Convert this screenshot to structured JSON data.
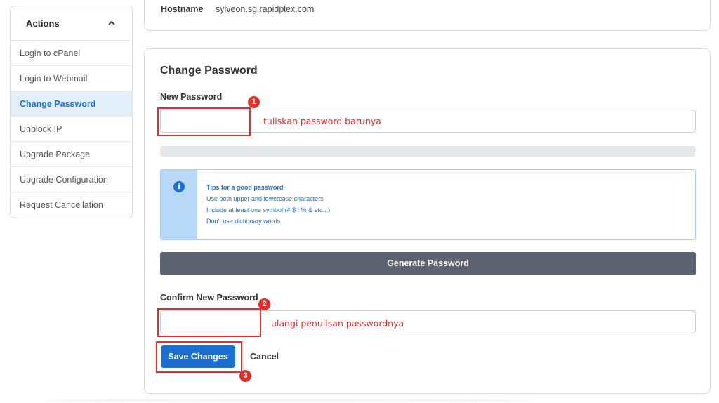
{
  "sidebar": {
    "title": "Actions",
    "items": [
      {
        "label": "Login to cPanel"
      },
      {
        "label": "Login to Webmail"
      },
      {
        "label": "Change Password"
      },
      {
        "label": "Unblock IP"
      },
      {
        "label": "Upgrade Package"
      },
      {
        "label": "Upgrade Configuration"
      },
      {
        "label": "Request Cancellation"
      }
    ]
  },
  "host": {
    "label": "Hostname",
    "value": "sylveon.sg.rapidplex.com"
  },
  "form": {
    "title": "Change Password",
    "new_password_label": "New Password",
    "confirm_label": "Confirm New Password",
    "generate_button": "Generate Password",
    "save_button": "Save Changes",
    "cancel": "Cancel"
  },
  "tips": {
    "title": "Tips for a good password",
    "lines": [
      "Use both upper and lowercase characters",
      "Include at least one symbol (# $ ! % & etc...)",
      "Don't use dictionary words"
    ]
  },
  "annotations": {
    "n1": "1",
    "n2": "2",
    "n3": "3",
    "text1": "tuliskan password barunya",
    "text2": "ulangi penulisan passwordnya"
  },
  "colors": {
    "accent": "#1a6fd1",
    "annotation": "#e0302a",
    "generate": "#5d6270"
  }
}
